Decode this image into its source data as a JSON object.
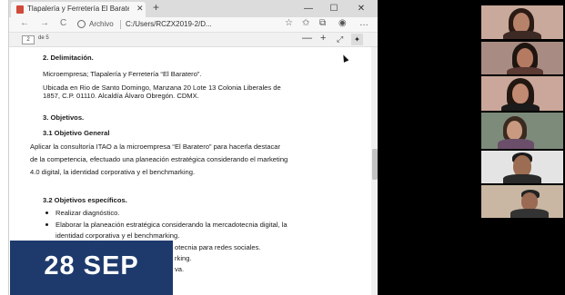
{
  "browser": {
    "tab_title": "Tlapalería y Ferretería El Baratero",
    "tab_close": "✕",
    "new_tab": "+",
    "window_controls": [
      "—",
      "☐",
      "✕"
    ],
    "address_label": "Archivo",
    "url": "C:/Users/RCZX2019-2/D...",
    "nav": {
      "back": "←",
      "forward": "→",
      "refresh": "C"
    },
    "toolbar_icons": [
      "star-icon",
      "favorites-icon",
      "collections-icon",
      "profile-icon",
      "more-icon"
    ]
  },
  "pdf_toolbar": {
    "page_number": "2",
    "page_count": "de 5",
    "zoom_out": "—",
    "zoom_in": "+",
    "fit": "⤢",
    "pin": "✦"
  },
  "document": {
    "delimitacion_heading": "2.   Delimitación.",
    "microempresa": "Microempresa; Tlapalería y Ferretería “El Baratero”.",
    "address_line1": "Ubicada en Rio de Santo Domingo, Manzana 20 Lote 13 Colonia Liberales de",
    "address_line2": "1857, C.P. 01110. Alcaldía Álvaro Obregón. CDMX.",
    "objetivos_heading": "3.   Objetivos.",
    "objetivo_general_heading": "3.1 Objetivo General",
    "general_line1": "Aplicar la consultoría ITAO a la microempresa “El Baratero” para hacerla destacar",
    "general_line2": "de la competencia, efectuado una planeación estratégica considerando el marketing",
    "general_line3": "4.0 digital, la identidad corporativa y el benchmarking.",
    "especificos_heading": "3.2 Objetivos específicos.",
    "bullet1": "Realizar diagnóstico.",
    "bullet2_line1": "Elaborar la planeación estratégica considerando la mercadotecnia digital, la",
    "bullet2_line2": "identidad corporativa y el benchmarking.",
    "bullet3_fragment": "otecnia para redes sociales.",
    "bullet4_fragment": "rking.",
    "bullet5_fragment": "va."
  },
  "overlay": {
    "date": "28 SEP"
  },
  "colors": {
    "date_badge": "#1e3a6d",
    "favicon": "#d14a3a"
  }
}
